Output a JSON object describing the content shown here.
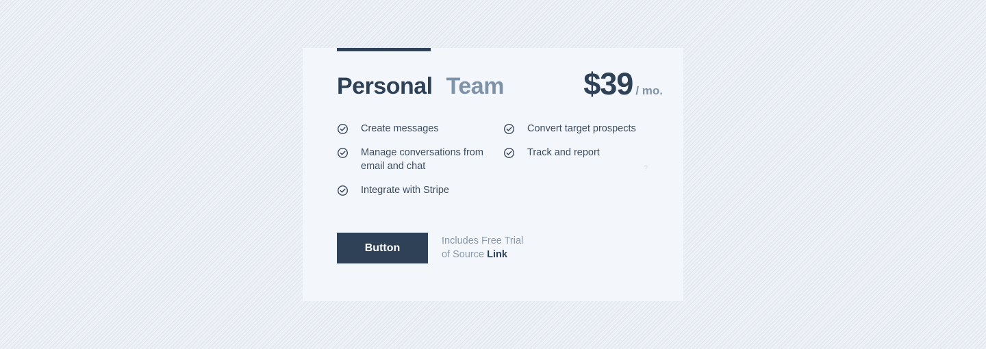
{
  "plan_tabs": {
    "personal_label": "Personal",
    "team_label": "Team",
    "active": "Personal"
  },
  "price": {
    "amount": "$39",
    "period": "/ mo."
  },
  "features": {
    "left": [
      {
        "text": "Create messages",
        "icon": "check-circle-icon"
      },
      {
        "text": "Manage conversations from email and chat",
        "icon": "check-circle-icon"
      },
      {
        "text": "Integrate with Stripe",
        "icon": "check-circle-icon"
      }
    ],
    "right": [
      {
        "text": "Convert target prospects",
        "icon": "check-circle-icon"
      },
      {
        "text": "Track and report",
        "icon": "check-circle-icon"
      }
    ],
    "help_mark": "?"
  },
  "cta": {
    "button_label": "Button",
    "trial_text_line1": "Includes Free Trial",
    "trial_text_line2": "of Source",
    "link_label": "Link"
  },
  "colors": {
    "primary": "#2e4157",
    "muted": "#7f93a8",
    "card_bg": "#f3f6fa",
    "page_bg": "#eef2f7"
  }
}
